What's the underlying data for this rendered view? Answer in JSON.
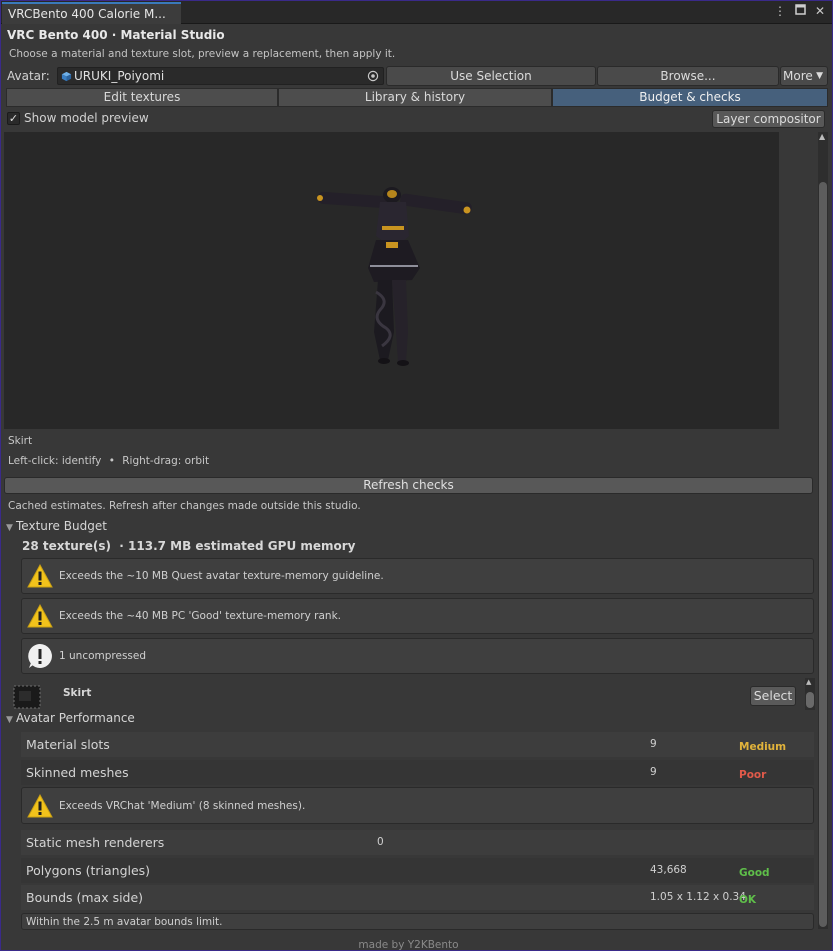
{
  "window": {
    "tab_title": "VRCBento 400 Calorie M...",
    "menu_icon": "kebab-menu-icon",
    "maximize_icon": "maximize-icon",
    "close_icon": "close-icon"
  },
  "header": {
    "title": "VRC Bento 400 · Material Studio",
    "subtitle": "Choose a material and texture slot, preview a replacement, then apply it."
  },
  "avatar_row": {
    "label": "Avatar:",
    "value": "URUKI_Poiyomi",
    "use_selection": "Use Selection",
    "browse": "Browse...",
    "more": "More"
  },
  "tabs": [
    {
      "label": "Edit textures",
      "active": false
    },
    {
      "label": "Library & history",
      "active": false
    },
    {
      "label": "Budget & checks",
      "active": true
    }
  ],
  "preview": {
    "show_preview_label": "Show model preview",
    "show_preview_checked": true,
    "layer_compositor": "Layer compositor",
    "hover_part": "Skirt",
    "hint_left": "Left-click: identify",
    "hint_sep": "•",
    "hint_right": "Right-drag: orbit"
  },
  "checks": {
    "refresh": "Refresh checks",
    "cached_note": "Cached estimates. Refresh after changes made outside this studio."
  },
  "texture_budget": {
    "heading": "Texture Budget",
    "summary": "28 texture(s)  · 113.7 MB estimated GPU memory",
    "messages": [
      {
        "icon": "warning-icon",
        "text": "Exceeds the ~10 MB Quest avatar texture-memory guideline."
      },
      {
        "icon": "warning-icon",
        "text": "Exceeds the ~40 MB PC 'Good' texture-memory rank."
      },
      {
        "icon": "info-exclamation-icon",
        "text": "1 uncompressed"
      }
    ],
    "item": {
      "name": "Skirt",
      "select": "Select"
    }
  },
  "performance": {
    "heading": "Avatar Performance",
    "rows": [
      {
        "name": "Material slots",
        "value": "9",
        "rank": "Medium",
        "rank_color": "#e1b33b"
      },
      {
        "name": "Skinned meshes",
        "value": "9",
        "rank": "Poor",
        "rank_color": "#e05a4a"
      }
    ],
    "skinned_warning": "Exceeds VRChat 'Medium' (8 skinned meshes).",
    "rows2": [
      {
        "name": "Static mesh renderers",
        "value": "0",
        "rank": "",
        "rank_color": ""
      },
      {
        "name": "Polygons (triangles)",
        "value": "43,668",
        "rank": "Good",
        "rank_color": "#5fbf4a"
      },
      {
        "name": "Bounds (max side)",
        "value": "1.05 x 1.12 x 0.34",
        "rank": "OK",
        "rank_color": "#5fbf4a"
      }
    ],
    "bounds_note": "Within the 2.5 m avatar bounds limit."
  },
  "footer": "made by Y2KBento"
}
